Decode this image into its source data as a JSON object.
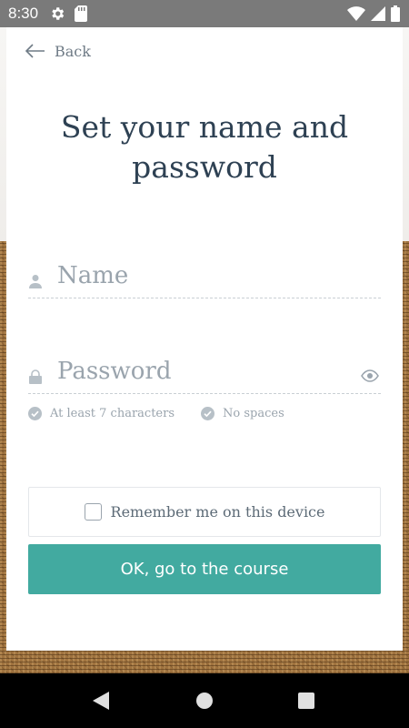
{
  "status_bar": {
    "time": "8:30",
    "left_icons": [
      "gear-icon",
      "sd-card-icon"
    ],
    "right_icons": [
      "wifi-icon",
      "signal-icon",
      "battery-icon"
    ]
  },
  "back": {
    "label": "Back",
    "icon": "arrow-left-icon"
  },
  "title": "Set your name and password",
  "name_field": {
    "placeholder": "Name",
    "value": "",
    "icon": "person-icon"
  },
  "password_field": {
    "placeholder": "Password",
    "value": "",
    "icon": "lock-icon",
    "toggle_icon": "eye-icon"
  },
  "rules": [
    {
      "label": "At least 7 characters",
      "icon": "check-circle-icon"
    },
    {
      "label": "No spaces",
      "icon": "check-circle-icon"
    }
  ],
  "remember": {
    "label": "Remember me on this device",
    "checked": false
  },
  "submit": {
    "label": "OK, go to the course"
  },
  "nav_bar": [
    "back-triangle-icon",
    "home-circle-icon",
    "recents-square-icon"
  ],
  "colors": {
    "accent": "#42aaa0",
    "title": "#2e4153",
    "muted": "#9aa4ad",
    "status_bar": "#7a7a7a"
  }
}
